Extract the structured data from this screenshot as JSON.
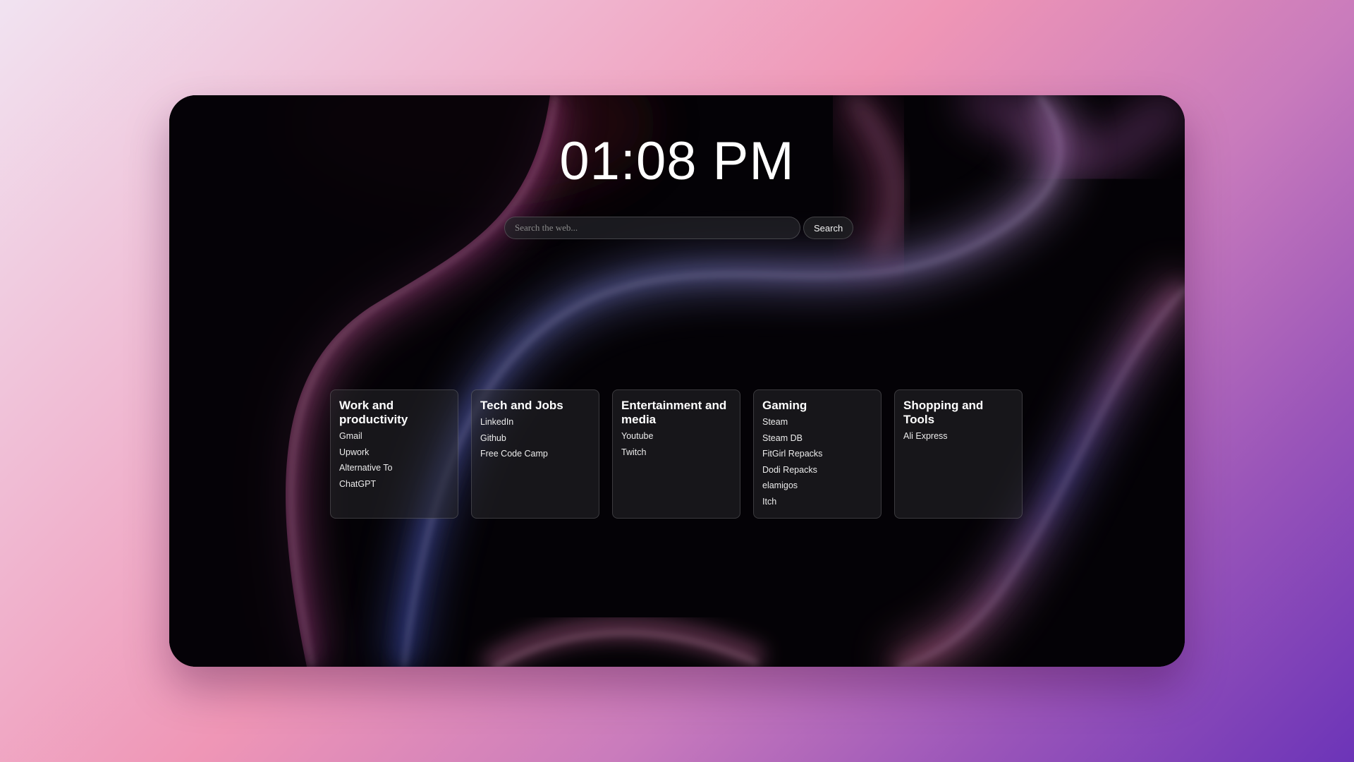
{
  "clock": {
    "time": "01:08 PM"
  },
  "search": {
    "placeholder": "Search the web...",
    "button_label": "Search"
  },
  "categories": [
    {
      "title": "Work and productivity",
      "links": [
        "Gmail",
        "Upwork",
        "Alternative To",
        "ChatGPT"
      ]
    },
    {
      "title": "Tech and Jobs",
      "links": [
        "LinkedIn",
        "Github",
        "Free Code Camp"
      ]
    },
    {
      "title": "Entertainment and media",
      "links": [
        "Youtube",
        "Twitch"
      ]
    },
    {
      "title": "Gaming",
      "links": [
        "Steam",
        "Steam DB",
        "FitGirl Repacks",
        "Dodi Repacks",
        "elamigos",
        "Itch"
      ]
    },
    {
      "title": "Shopping and Tools",
      "links": [
        "Ali Express"
      ]
    }
  ],
  "colors": {
    "ribbon_pink": "#e0609e",
    "ribbon_blue": "#6f7ee6",
    "ribbon_purple": "#a77fd6",
    "window_bg": "#050307"
  }
}
